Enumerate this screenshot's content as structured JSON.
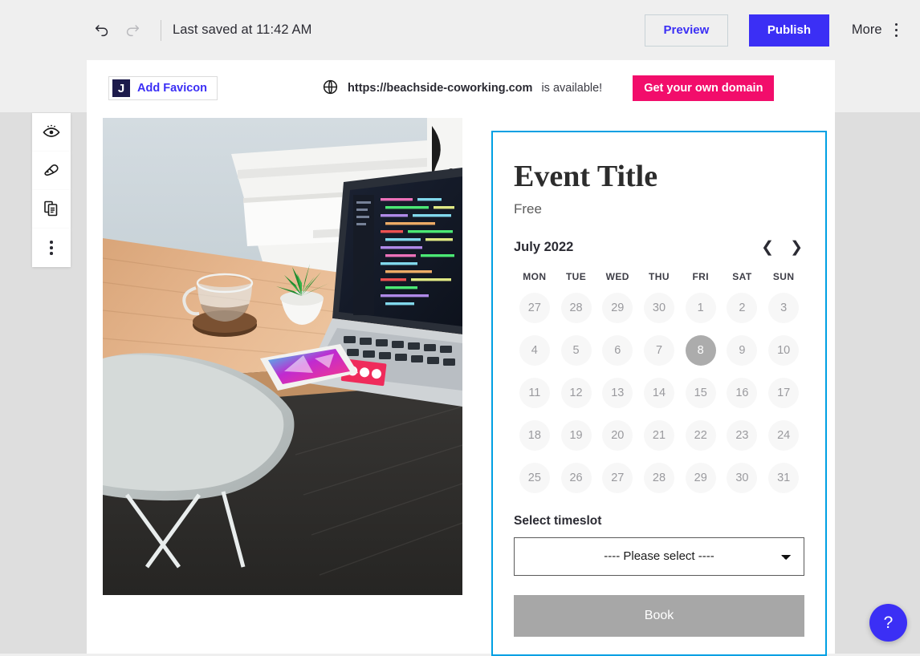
{
  "toolbar": {
    "undo_icon": "undo-icon",
    "redo_icon": "redo-icon",
    "saved_status": "Last saved at 11:42 AM",
    "preview_label": "Preview",
    "publish_label": "Publish",
    "more_label": "More",
    "more_icon": "vertical-dots-icon",
    "accent_blue": "#3b2ff5"
  },
  "tool_rail": {
    "items": [
      {
        "icon": "eye-icon",
        "name": "visibility"
      },
      {
        "icon": "palette-icon",
        "name": "design"
      },
      {
        "icon": "duplicate-icon",
        "name": "duplicate"
      },
      {
        "icon": "vertical-dots-icon",
        "name": "more-options"
      }
    ]
  },
  "site_bar": {
    "favicon_letter": "J",
    "add_favicon_label": "Add Favicon",
    "globe_icon": "globe-icon",
    "domain": "https://beachside-coworking.com",
    "availability": "is available!",
    "get_domain_label": "Get your own domain",
    "cta_color": "#f20d6b"
  },
  "hero": {
    "alt": "Wooden desk with laptop showing code, glass mug, succulent plant and smartphone"
  },
  "event_card": {
    "border_color": "#00a0e3",
    "title": "Event Title",
    "price": "Free",
    "calendar": {
      "month_label": "July 2022",
      "prev_icon": "chevron-left-icon",
      "next_icon": "chevron-right-icon",
      "weekdays": [
        "MON",
        "TUE",
        "WED",
        "THU",
        "FRI",
        "SAT",
        "SUN"
      ],
      "weeks": [
        [
          {
            "day": "27",
            "muted": true,
            "selected": false
          },
          {
            "day": "28",
            "muted": true,
            "selected": false
          },
          {
            "day": "29",
            "muted": true,
            "selected": false
          },
          {
            "day": "30",
            "muted": true,
            "selected": false
          },
          {
            "day": "1",
            "muted": false,
            "selected": false
          },
          {
            "day": "2",
            "muted": false,
            "selected": false
          },
          {
            "day": "3",
            "muted": false,
            "selected": false
          }
        ],
        [
          {
            "day": "4",
            "muted": false,
            "selected": false
          },
          {
            "day": "5",
            "muted": false,
            "selected": false
          },
          {
            "day": "6",
            "muted": false,
            "selected": false
          },
          {
            "day": "7",
            "muted": false,
            "selected": false
          },
          {
            "day": "8",
            "muted": false,
            "selected": true
          },
          {
            "day": "9",
            "muted": false,
            "selected": false
          },
          {
            "day": "10",
            "muted": false,
            "selected": false
          }
        ],
        [
          {
            "day": "11",
            "muted": false,
            "selected": false
          },
          {
            "day": "12",
            "muted": false,
            "selected": false
          },
          {
            "day": "13",
            "muted": false,
            "selected": false
          },
          {
            "day": "14",
            "muted": false,
            "selected": false
          },
          {
            "day": "15",
            "muted": false,
            "selected": false
          },
          {
            "day": "16",
            "muted": false,
            "selected": false
          },
          {
            "day": "17",
            "muted": false,
            "selected": false
          }
        ],
        [
          {
            "day": "18",
            "muted": false,
            "selected": false
          },
          {
            "day": "19",
            "muted": false,
            "selected": false
          },
          {
            "day": "20",
            "muted": false,
            "selected": false
          },
          {
            "day": "21",
            "muted": false,
            "selected": false
          },
          {
            "day": "22",
            "muted": false,
            "selected": false
          },
          {
            "day": "23",
            "muted": false,
            "selected": false
          },
          {
            "day": "24",
            "muted": false,
            "selected": false
          }
        ],
        [
          {
            "day": "25",
            "muted": false,
            "selected": false
          },
          {
            "day": "26",
            "muted": false,
            "selected": false
          },
          {
            "day": "27",
            "muted": false,
            "selected": false
          },
          {
            "day": "28",
            "muted": false,
            "selected": false
          },
          {
            "day": "29",
            "muted": false,
            "selected": false
          },
          {
            "day": "30",
            "muted": false,
            "selected": false
          },
          {
            "day": "31",
            "muted": false,
            "selected": false
          }
        ]
      ]
    },
    "timeslot_label": "Select timeslot",
    "timeslot_selected": "---- Please select ----",
    "timeslot_options": [
      "---- Please select ----"
    ],
    "book_label": "Book"
  },
  "help": {
    "label": "?",
    "icon": "question-mark-icon"
  }
}
